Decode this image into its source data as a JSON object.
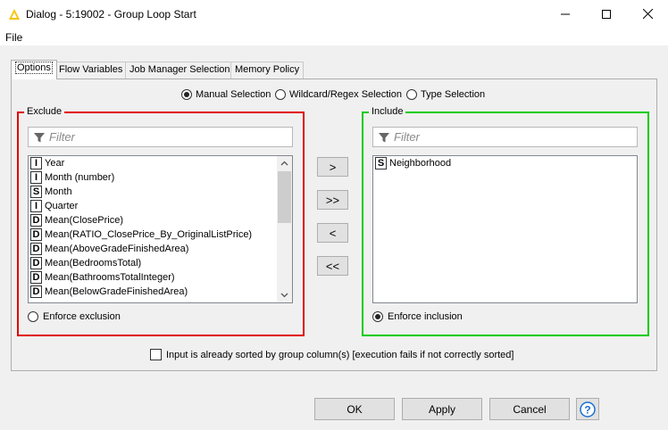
{
  "window": {
    "title": "Dialog - 5:19002 - Group Loop Start",
    "icons": [
      "knime-app-icon",
      "minimize-icon",
      "maximize-icon",
      "close-icon"
    ]
  },
  "menu": {
    "file": "File"
  },
  "tabs": [
    {
      "label": "Options",
      "active": true
    },
    {
      "label": "Flow Variables",
      "active": false
    },
    {
      "label": "Job Manager Selection",
      "active": false
    },
    {
      "label": "Memory Policy",
      "active": false
    }
  ],
  "selection_modes": [
    {
      "label": "Manual Selection",
      "selected": true
    },
    {
      "label": "Wildcard/Regex Selection",
      "selected": false
    },
    {
      "label": "Type Selection",
      "selected": false
    }
  ],
  "exclude": {
    "title": "Exclude",
    "border_color": "#e00000",
    "filter_placeholder": "Filter",
    "items": [
      {
        "type": "I",
        "name": "Year"
      },
      {
        "type": "I",
        "name": "Month (number)"
      },
      {
        "type": "S",
        "name": "Month"
      },
      {
        "type": "I",
        "name": "Quarter"
      },
      {
        "type": "D",
        "name": "Mean(ClosePrice)"
      },
      {
        "type": "D",
        "name": "Mean(RATIO_ClosePrice_By_OriginalListPrice)"
      },
      {
        "type": "D",
        "name": "Mean(AboveGradeFinishedArea)"
      },
      {
        "type": "D",
        "name": "Mean(BedroomsTotal)"
      },
      {
        "type": "D",
        "name": "Mean(BathroomsTotalInteger)"
      },
      {
        "type": "D",
        "name": "Mean(BelowGradeFinishedArea)"
      }
    ],
    "enforce_label": "Enforce exclusion",
    "enforce_selected": false
  },
  "include": {
    "title": "Include",
    "border_color": "#00cc00",
    "filter_placeholder": "Filter",
    "items": [
      {
        "type": "S",
        "name": "Neighborhood"
      }
    ],
    "enforce_label": "Enforce inclusion",
    "enforce_selected": true
  },
  "move_buttons": [
    ">",
    ">>",
    "<",
    "<<"
  ],
  "sorted_checkbox": {
    "label": "Input is already sorted by group column(s) [execution fails if not correctly sorted]",
    "checked": false
  },
  "buttons": {
    "ok": "OK",
    "apply": "Apply",
    "cancel": "Cancel"
  }
}
